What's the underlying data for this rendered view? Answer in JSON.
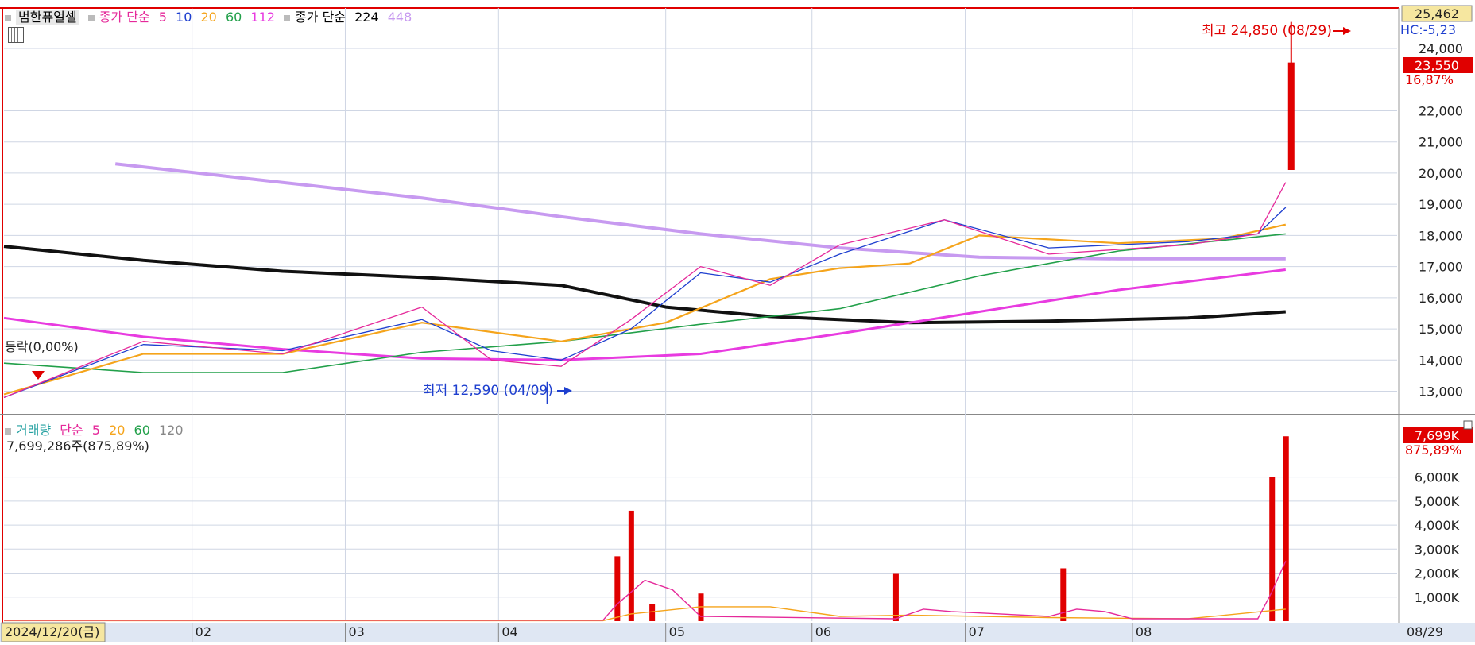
{
  "price_legend": {
    "stock_name": "범한퓨얼셀",
    "ma_label": "종가 단순",
    "ma_periods": [
      "5",
      "10",
      "20",
      "60",
      "112"
    ],
    "ma_colors": [
      "#e5299a",
      "#1e3fcf",
      "#f5a41b",
      "#22a04a",
      "#e83be0"
    ],
    "ma2_label": "종가 단순",
    "ma2_periods": [
      "224",
      "448"
    ],
    "ma2_colors": [
      "#000000",
      "#c79af0"
    ]
  },
  "volume_legend": {
    "label": "거래량",
    "ma_label": "단순",
    "ma_periods": [
      "5",
      "20",
      "60",
      "120"
    ],
    "ma_colors": [
      "#e5299a",
      "#f5a41b",
      "#22a04a",
      "#888888"
    ],
    "value_text": "7,699,286주(875,89%)"
  },
  "price_panel": {
    "current_price_box": "25,462",
    "hc_text": "HC:-5,23",
    "last_price_box": "23,550",
    "last_change_pct": "16,87%",
    "high_annotation": "최고 24,850 (08/29)",
    "low_annotation": "최저 12,590 (04/09)",
    "left_annotation": "등락(0,00%)",
    "y_ticks": [
      "24,000",
      "22,000",
      "21,000",
      "20,000",
      "19,000",
      "18,000",
      "17,000",
      "16,000",
      "15,000",
      "14,000",
      "13,000"
    ],
    "grid": true
  },
  "volume_panel": {
    "last_volume_box": "7,699K",
    "last_change_pct": "875,89%",
    "y_ticks": [
      "6,000K",
      "5,000K",
      "4,000K",
      "3,000K",
      "2,000K",
      "1,000K"
    ]
  },
  "x_axis": {
    "start_label": "2024/12/20(금)",
    "month_labels": [
      "02",
      "03",
      "04",
      "05",
      "06",
      "07",
      "08"
    ],
    "end_label": "08/29"
  },
  "chart_data": {
    "type": "candlestick",
    "y_range": [
      12300,
      25300
    ],
    "x_range": [
      0,
      200
    ],
    "month_x": [
      27,
      49,
      71,
      95,
      116,
      138,
      162
    ],
    "high_point": {
      "x": 184.8,
      "price": 24850
    },
    "low_point": {
      "x": 78.0,
      "price": 12590
    },
    "ma_224": [
      [
        0,
        17650
      ],
      [
        20,
        17200
      ],
      [
        40,
        16850
      ],
      [
        60,
        16650
      ],
      [
        80,
        16400
      ],
      [
        95,
        15700
      ],
      [
        110,
        15400
      ],
      [
        130,
        15200
      ],
      [
        150,
        15250
      ],
      [
        170,
        15350
      ],
      [
        184,
        15550
      ]
    ],
    "ma_448": [
      [
        16,
        20300
      ],
      [
        40,
        19700
      ],
      [
        60,
        19200
      ],
      [
        80,
        18600
      ],
      [
        100,
        18050
      ],
      [
        120,
        17600
      ],
      [
        140,
        17300
      ],
      [
        160,
        17250
      ],
      [
        184,
        17250
      ]
    ],
    "ma_112": [
      [
        0,
        15350
      ],
      [
        20,
        14750
      ],
      [
        40,
        14350
      ],
      [
        60,
        14050
      ],
      [
        80,
        14000
      ],
      [
        100,
        14200
      ],
      [
        120,
        14850
      ],
      [
        140,
        15550
      ],
      [
        160,
        16250
      ],
      [
        184,
        16900
      ]
    ],
    "ma_60": [
      [
        0,
        13900
      ],
      [
        20,
        13600
      ],
      [
        40,
        13600
      ],
      [
        60,
        14250
      ],
      [
        80,
        14600
      ],
      [
        100,
        15150
      ],
      [
        120,
        15650
      ],
      [
        140,
        16700
      ],
      [
        160,
        17500
      ],
      [
        184,
        18050
      ]
    ],
    "ma_20": [
      [
        0,
        12900
      ],
      [
        20,
        14200
      ],
      [
        40,
        14200
      ],
      [
        60,
        15200
      ],
      [
        80,
        14600
      ],
      [
        95,
        15200
      ],
      [
        110,
        16600
      ],
      [
        120,
        16950
      ],
      [
        130,
        17100
      ],
      [
        140,
        18000
      ],
      [
        160,
        17750
      ],
      [
        175,
        17900
      ],
      [
        184,
        18350
      ]
    ],
    "ma_10": [
      [
        0,
        12800
      ],
      [
        20,
        14500
      ],
      [
        40,
        14300
      ],
      [
        60,
        15300
      ],
      [
        70,
        14300
      ],
      [
        80,
        14000
      ],
      [
        90,
        15000
      ],
      [
        100,
        16800
      ],
      [
        110,
        16500
      ],
      [
        120,
        17400
      ],
      [
        135,
        18500
      ],
      [
        150,
        17600
      ],
      [
        170,
        17800
      ],
      [
        180,
        18050
      ],
      [
        184,
        18900
      ]
    ],
    "ma_5": [
      [
        0,
        12800
      ],
      [
        20,
        14600
      ],
      [
        40,
        14200
      ],
      [
        60,
        15700
      ],
      [
        70,
        14000
      ],
      [
        80,
        13800
      ],
      [
        90,
        15300
      ],
      [
        100,
        17000
      ],
      [
        110,
        16400
      ],
      [
        120,
        17700
      ],
      [
        135,
        18500
      ],
      [
        150,
        17400
      ],
      [
        170,
        17700
      ],
      [
        180,
        18050
      ],
      [
        184,
        19700
      ]
    ],
    "volume_ma5": [
      [
        0,
        40
      ],
      [
        86,
        40
      ],
      [
        88,
        700
      ],
      [
        92,
        1700
      ],
      [
        96,
        1300
      ],
      [
        100,
        200
      ],
      [
        128,
        100
      ],
      [
        132,
        500
      ],
      [
        136,
        400
      ],
      [
        150,
        200
      ],
      [
        154,
        500
      ],
      [
        158,
        400
      ],
      [
        162,
        100
      ],
      [
        180,
        100
      ],
      [
        182,
        1200
      ],
      [
        184,
        2500
      ]
    ],
    "volume_ma20": [
      [
        0,
        20
      ],
      [
        86,
        20
      ],
      [
        90,
        300
      ],
      [
        100,
        600
      ],
      [
        110,
        600
      ],
      [
        120,
        200
      ],
      [
        130,
        250
      ],
      [
        150,
        150
      ],
      [
        170,
        100
      ],
      [
        184,
        500
      ]
    ],
    "volume_spikes": [
      [
        88,
        2700
      ],
      [
        90,
        4600
      ],
      [
        93,
        700
      ],
      [
        100,
        1150
      ],
      [
        128,
        2000
      ],
      [
        152,
        2200
      ],
      [
        182,
        6000
      ],
      [
        184,
        7699
      ]
    ]
  }
}
